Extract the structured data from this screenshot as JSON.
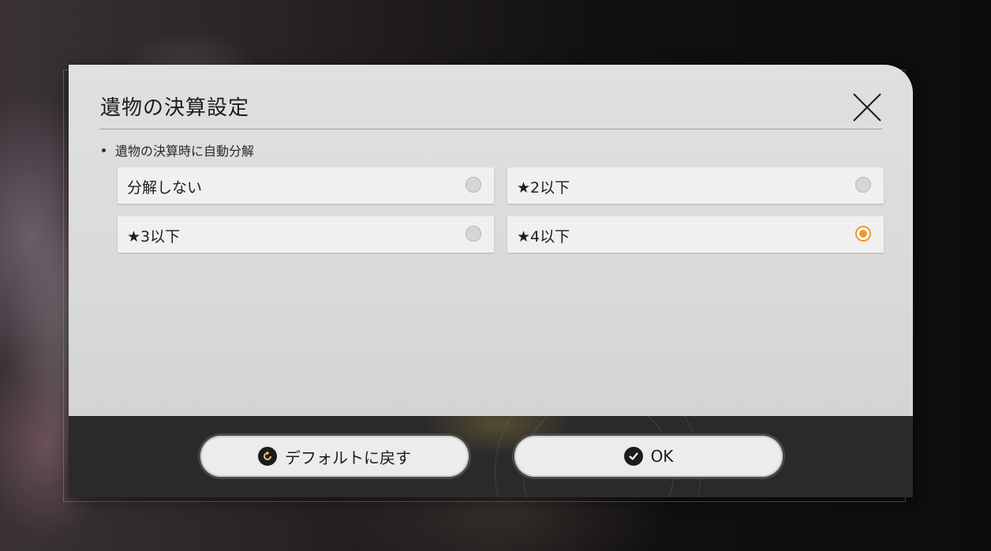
{
  "dialog": {
    "title": "遺物の決算設定",
    "section_label": "遺物の決算時に自動分解",
    "options": [
      {
        "label": "分解しない",
        "selected": false
      },
      {
        "label": "★2以下",
        "selected": false
      },
      {
        "label": "★3以下",
        "selected": false
      },
      {
        "label": "★4以下",
        "selected": true
      }
    ],
    "close_icon": "close-x-icon"
  },
  "footer": {
    "default_button_label": "デフォルトに戻す",
    "default_button_icon": "reset-icon",
    "ok_button_label": "OK",
    "ok_button_icon": "check-icon"
  },
  "colors": {
    "accent": "#ee9a2a",
    "dialog_bg": "#dadada",
    "footer_bg": "#2b2a2a"
  }
}
